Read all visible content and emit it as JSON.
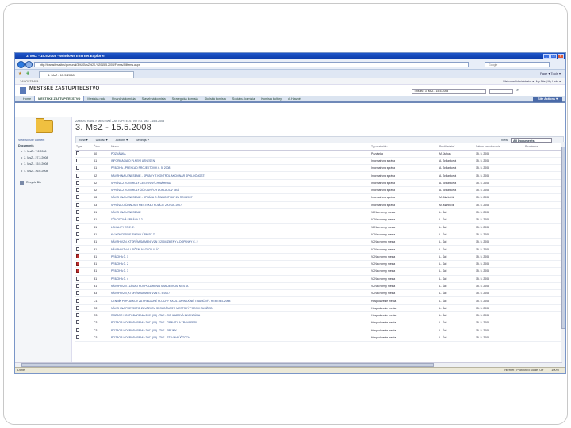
{
  "window": {
    "title": "3. MsZ - 15.5.2008 - Windows Internet Explorer",
    "address": "http://teamsites/sites/pomunal/3%20MsZ%20-%2015.5.2008/Forms/AllItems.aspx",
    "search_placeholder": "Google",
    "tab_label": "3. MsZ - 15.5.2008",
    "toolbar_right": "Page ▾  Tools ▾"
  },
  "sp": {
    "top_left": "ZAMOSTRAVA",
    "top_right": "Welcome Administrator ▾ | My Site | My Links ▾",
    "site_title": "MESTSKÉ ZASTUPITEĽSTVO",
    "search_scope": "This list: 3. MsZ - 15.5.2008",
    "site_actions": "Site Actions ▾",
    "nav": [
      "Home",
      "MESTSKÉ ZASTUPITEĽSTVO",
      "Mestská rada",
      "Finančná komisia",
      "Stavebná komisia",
      "Strategická komisia",
      "Školská komisia",
      "Sociálna komisia",
      "Komisia kultúry",
      "ul.Hlavné"
    ]
  },
  "leftnav": {
    "view_all": "View All Site Content",
    "documents_heading": "Documents",
    "documents": [
      "1. MsZ - 7.2.2008",
      "2. MsZ - 27.3.2008",
      "3. MsZ - 15.5.2008",
      "4. MsZ - 26.6.2008"
    ],
    "recycle_bin": "Recycle Bin"
  },
  "main": {
    "breadcrumb": "ZAMOSTRAVA > MESTSKÉ ZASTUPITEĽSTVO > 3. MsZ - 15.5.2008",
    "title": "3. MsZ - 15.5.2008",
    "toolbar": [
      "New ▾",
      "Upload ▾",
      "Actions ▾",
      "Settings ▾"
    ],
    "view_label": "View:",
    "view_value": "All Documents",
    "columns": [
      "Type",
      "Číslo",
      "Názov",
      "Typ materiálu",
      "Predkladateľ",
      "Dátum prerokovania",
      "Poznámka"
    ]
  },
  "rows": [
    {
      "icon": "doc",
      "cislo": "A0",
      "nazov": "POZVÁNKA",
      "typ": "Pozvánka",
      "pred": "M. Jurkas",
      "datum": "15. 5. 2008"
    },
    {
      "icon": "doc",
      "cislo": "A1",
      "nazov": "INFORMÁCIA O PLNENÍ UZNESENÍ",
      "typ": "Informatívna správa",
      "pred": "A. Srdlanková",
      "datum": "15. 5. 2008"
    },
    {
      "icon": "doc",
      "cislo": "A1",
      "nazov": "PRÍLOHA - PREHĽAD PROJEKTOV K 6. 5. 2008",
      "typ": "Informatívna správa",
      "pred": "A. Srdlanková",
      "datum": "15. 5. 2008"
    },
    {
      "icon": "doc",
      "cislo": "A2",
      "nazov": "NÁVRH NA UZNESENIE - SPRÁVY Z KONTROL AKCIONÁR SPOLOČNOSTI",
      "typ": "Informatívna správa",
      "pred": "A. Srdlanková",
      "datum": "15. 5. 2008"
    },
    {
      "icon": "doc",
      "cislo": "A2",
      "nazov": "SPRÁVA Z KONTROLY CESTOVNÝCH NÁHRAD",
      "typ": "Informatívna správa",
      "pred": "A. Srdlanková",
      "datum": "15. 5. 2008"
    },
    {
      "icon": "doc",
      "cislo": "A2",
      "nazov": "SPRÁVA Z KONTROLY ÚČTOVNÝCH DOKLADOV MSÚ",
      "typ": "Informatívna správa",
      "pred": "A. Srdlanková",
      "datum": "15. 5. 2008"
    },
    {
      "icon": "doc",
      "cislo": "A3",
      "nazov": "NÁVRH NA UZNESENIE - SPRÁVA O ČINNOSTI MP ZA ROK 2007",
      "typ": "Informatívna správa",
      "pred": "M. Martinčík",
      "datum": "15. 5. 2008"
    },
    {
      "icon": "doc",
      "cislo": "A3",
      "nazov": "SPRÁVA O ČINNOSTI MESTSKEJ POLÍCIE ZA ROK 2007",
      "typ": "Informatívna správa",
      "pred": "M. Martinčík",
      "datum": "15. 5. 2008"
    },
    {
      "icon": "doc",
      "cislo": "B1",
      "nazov": "NÁVRH NA UZNESENIE",
      "typ": "VZN a normy mesta",
      "pred": "L. Šáli",
      "datum": "15. 5. 2008"
    },
    {
      "icon": "doc",
      "cislo": "B1",
      "nazov": "DÔVODOVÁ SPRÁVA Z.2",
      "typ": "VZN a normy mesta",
      "pred": "L. Šáli",
      "datum": "15. 5. 2008"
    },
    {
      "icon": "doc",
      "cislo": "B1",
      "nazov": "LOKALITY ES Z. Z.",
      "typ": "VZN a normy mesta",
      "pred": "L. Šáli",
      "datum": "15. 5. 2008"
    },
    {
      "icon": "doc",
      "cislo": "B1",
      "nazov": "KV-KONCEPCIE ZMENY ÚPN SK Z.",
      "typ": "VZN a normy mesta",
      "pred": "L. Šáli",
      "datum": "15. 5. 2008"
    },
    {
      "icon": "doc",
      "cislo": "B1",
      "nazov": "NÁVRH VZN, KTORÝM SA MENÍ VZN 1/2004 ZMENY A DOPLNKY Č. 2",
      "typ": "VZN a normy mesta",
      "pred": "L. Šáli",
      "datum": "15. 5. 2008"
    },
    {
      "icon": "doc",
      "cislo": "B1",
      "nazov": "NÁVRH VZN O URČENÍ NÁZVOV ULÍC",
      "typ": "VZN a normy mesta",
      "pred": "L. Šáli",
      "datum": "15. 5. 2008"
    },
    {
      "icon": "pdf",
      "cislo": "B1",
      "nazov": "PRÍLOHA Č. 1",
      "typ": "VZN a normy mesta",
      "pred": "L. Šáli",
      "datum": "15. 5. 2008"
    },
    {
      "icon": "pdf",
      "cislo": "B1",
      "nazov": "PRÍLOHA Č. 2",
      "typ": "VZN a normy mesta",
      "pred": "L. Šáli",
      "datum": "15. 5. 2008"
    },
    {
      "icon": "pdf",
      "cislo": "B1",
      "nazov": "PRÍLOHA Č. 3",
      "typ": "VZN a normy mesta",
      "pred": "L. Šáli",
      "datum": "15. 5. 2008"
    },
    {
      "icon": "doc",
      "cislo": "B1",
      "nazov": "PRÍLOHA Č. 4",
      "typ": "VZN a normy mesta",
      "pred": "L. Šáli",
      "datum": "15. 5. 2008"
    },
    {
      "icon": "doc",
      "cislo": "B1",
      "nazov": "NÁVRH VZN - ZÁSAD HOSPODÁRENIA S MAJETKOM MESTA",
      "typ": "VZN a normy mesta",
      "pred": "L. Šáli",
      "datum": "15. 5. 2008"
    },
    {
      "icon": "doc",
      "cislo": "B3",
      "nazov": "NÁVRH VZN, KTORÝM SA MENÍ VZN Č. 5/2007",
      "typ": "VZN a normy mesta",
      "pred": "L. Šáli",
      "datum": "15. 5. 2008"
    },
    {
      "icon": "doc",
      "cislo": "C1",
      "nazov": "CENNÍK POPLATKOV ZA PREDAJNÉ PLOCHY NA UL. JARMOČNÉ TRADIČNÝ - REMESEL 2008",
      "typ": "Hospodárenie mesta",
      "pred": "L. Šáli",
      "datum": "15. 5. 2008"
    },
    {
      "icon": "doc",
      "cislo": "C2",
      "nazov": "NÁVRH NA PREVZATIE ZÁVÄZKOV SPOLOČNOSTI MESTSKÝ PODNIK SLUŽIEB",
      "typ": "Hospodárenie mesta",
      "pred": "L. Šáli",
      "datum": "15. 5. 2008"
    },
    {
      "icon": "doc",
      "cislo": "C3",
      "nazov": "ROZBOR HOSPODÁRENIA 2007 (03) - TAE - OCHLADOVÁ INVENTÚRA",
      "typ": "Hospodárenie mesta",
      "pred": "L. Šáli",
      "datum": "15. 5. 2008"
    },
    {
      "icon": "doc",
      "cislo": "C3",
      "nazov": "ROZBOR HOSPODÁRENIA 2007 (03) - TAE - GRAVITY A TRANSFERY",
      "typ": "Hospodárenie mesta",
      "pred": "L. Šáli",
      "datum": "15. 5. 2008"
    },
    {
      "icon": "doc",
      "cislo": "C3",
      "nazov": "ROZBOR HOSPODÁRENIA 2007 (03) - TAE - PRÍJMY",
      "typ": "Hospodárenie mesta",
      "pred": "L. Šáli",
      "datum": "15. 5. 2008"
    },
    {
      "icon": "doc",
      "cislo": "C3",
      "nazov": "ROZBOR HOSPODÁRENIA 2007 (03) - TAE - STAV NA ÚČTOCH",
      "typ": "Hospodárenie mesta",
      "pred": "L. Šáli",
      "datum": "15. 5. 2008"
    }
  ],
  "status": {
    "left": "Done",
    "zone": "Internet | Protected Mode: Off",
    "zoom": "100%"
  }
}
